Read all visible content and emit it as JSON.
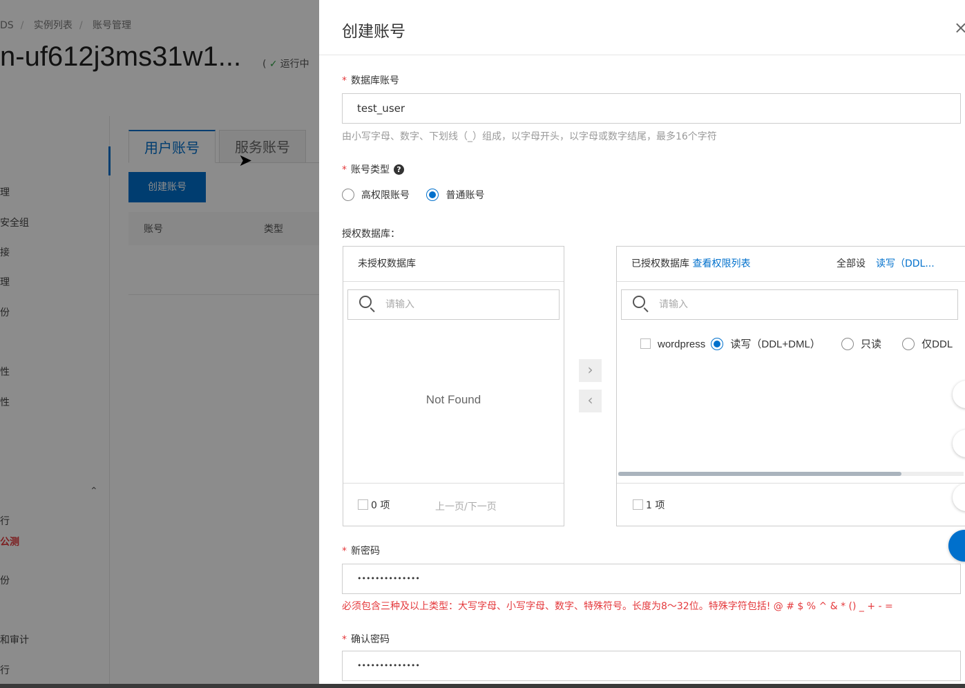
{
  "background": {
    "breadcrumb": [
      "DS",
      "实例列表",
      "账号管理"
    ],
    "title": "n-uf612j3ms31w1...",
    "status": "运行中",
    "sidebar_items": [
      "理",
      "安全组",
      "接",
      "理",
      "份",
      "性",
      "性",
      "行",
      "公测",
      "份",
      "和审计",
      "行"
    ],
    "tabs": [
      "用户账号",
      "服务账号"
    ],
    "create_button": "创建账号",
    "table_headers": [
      "账号",
      "类型"
    ]
  },
  "drawer": {
    "title": "创建账号",
    "close_icon": "close-icon",
    "account": {
      "label": "数据库账号",
      "value": "test_user",
      "hint": "由小写字母、数字、下划线（_）组成，以字母开头，以字母或数字结尾，最多16个字符"
    },
    "account_type": {
      "label": "账号类型",
      "options": [
        "高权限账号",
        "普通账号"
      ],
      "selected": "普通账号"
    },
    "grant": {
      "label": "授权数据库：",
      "unauthorized": {
        "title": "未授权数据库",
        "search_placeholder": "请输入",
        "empty_text": "Not Found",
        "count": "0 项",
        "pager": "上一页/下一页"
      },
      "authorized": {
        "title": "已授权数据库",
        "view_link": "查看权限列表",
        "set_all_label": "全部设",
        "set_all_link": "读写（DDL...",
        "search_placeholder": "请输入",
        "db_name": "wordpress",
        "perm_options": [
          "读写（DDL+DML）",
          "只读",
          "仅DDL"
        ],
        "selected_perm": "读写（DDL+DML）",
        "count": "1 项"
      }
    },
    "new_password": {
      "label": "新密码",
      "value": "••••••••••••••",
      "error": "必须包含三种及以上类型：大写字母、小写字母、数字、特殊符号。长度为8～32位。特殊字符包括! @ # $ % ^ & * () _ + - ="
    },
    "confirm_password": {
      "label": "确认密码",
      "value": "••••••••••••••"
    }
  },
  "colors": {
    "accent": "#0070cc",
    "error": "#e4393c"
  }
}
